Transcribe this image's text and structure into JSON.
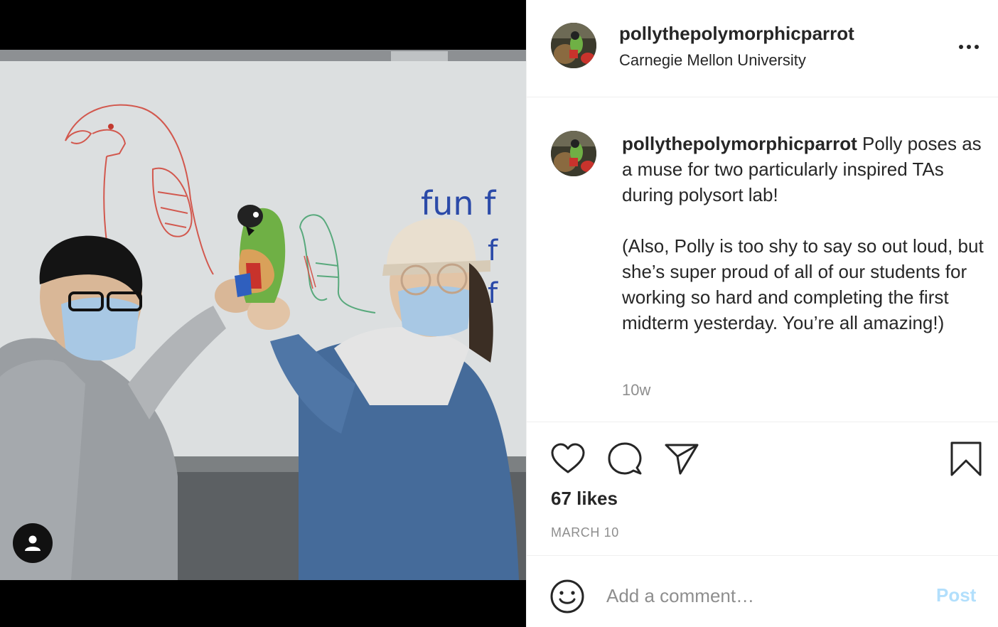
{
  "post": {
    "username": "pollythepolymorphicparrot",
    "location": "Carnegie Mellon University",
    "caption_username": "pollythepolymorphicparrot",
    "caption_line1": " Polly poses as a muse for two particularly inspired TAs during polysort lab!",
    "caption_line2": "(Also, Polly is too shy to say so out loud, but she’s super proud of all of our students for working so hard and completing the first midterm yesterday. You’re all amazing!)",
    "time_ago": "10w",
    "likes": "67 likes",
    "date": "MARCH 10"
  },
  "photo": {
    "whiteboard_text": "fun f"
  },
  "comment_box": {
    "placeholder": "Add a comment…",
    "post_label": "Post"
  },
  "colors": {
    "post_button_disabled": "#b2dffc",
    "secondary_text": "#8e8e8e",
    "divider": "#efefef"
  },
  "icons": {
    "more": "more-options-icon",
    "like": "heart-icon",
    "comment": "comment-bubble-icon",
    "share": "paper-plane-icon",
    "save": "bookmark-icon",
    "emoji": "smiley-icon",
    "user_tag": "person-icon"
  }
}
